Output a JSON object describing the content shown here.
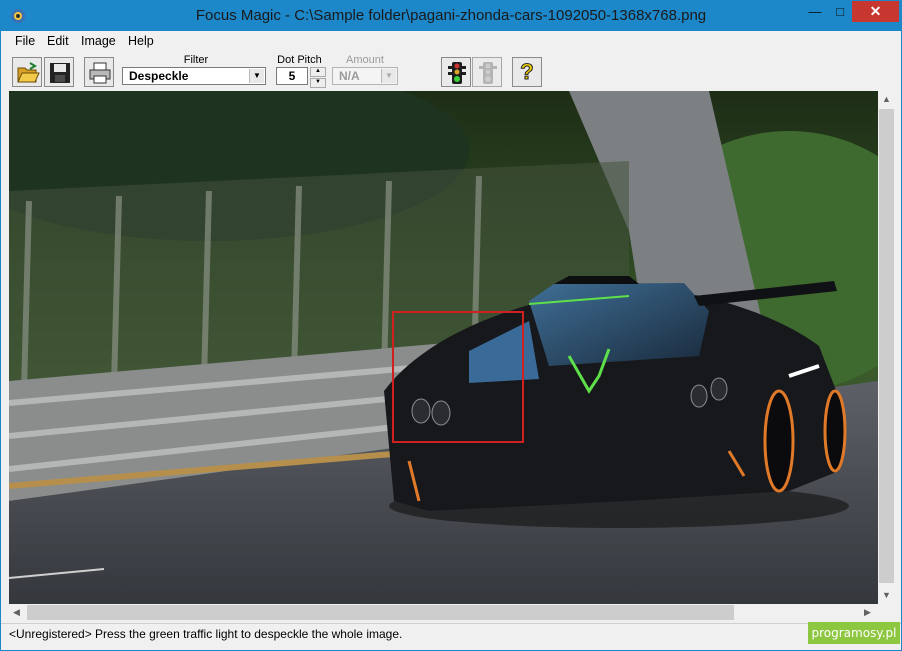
{
  "window": {
    "title": "Focus Magic - C:\\Sample folder\\pagani-zhonda-cars-1092050-1368x768.png",
    "min_glyph": "—",
    "max_glyph": "□",
    "close_glyph": "✕"
  },
  "menu": [
    "File",
    "Edit",
    "Image",
    "Help"
  ],
  "toolbar": {
    "open_icon": "open-folder-icon",
    "save_icon": "floppy-disk-icon",
    "print_icon": "printer-icon",
    "filter_label": "Filter",
    "filter_value": "Despeckle",
    "dot_pitch_label": "Dot Pitch",
    "dot_pitch_value": "5",
    "amount_label": "Amount",
    "amount_value": "N/A",
    "go_icon": "green-traffic-light-icon",
    "stop_icon": "grey-traffic-light-icon",
    "help_icon": "question-mark-icon",
    "help_glyph": "?"
  },
  "colors": {
    "titlebar": "#1c87c9",
    "selection": "#d0201f",
    "car_body": "#17181c",
    "accent_green": "#5ee04a",
    "accent_orange": "#e07a28"
  },
  "status": {
    "text": "<Unregistered>  Press the green traffic light to despeckle the whole image."
  },
  "watermark": "programosy.pl"
}
